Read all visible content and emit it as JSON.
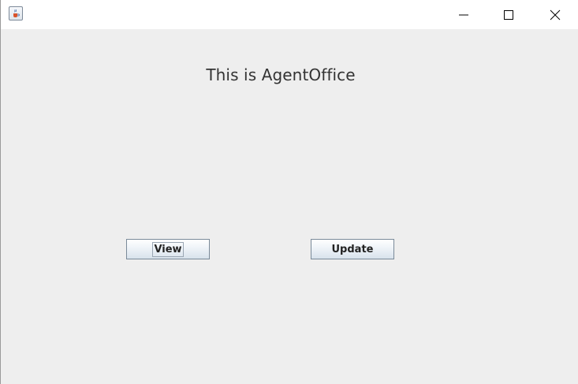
{
  "window": {
    "icon": "java-cup-icon",
    "controls": {
      "minimize_icon": "minimize-icon",
      "maximize_icon": "maximize-icon",
      "close_icon": "close-icon"
    }
  },
  "main": {
    "heading": "This is AgentOffice",
    "buttons": {
      "view_label": "View",
      "update_label": "Update"
    }
  },
  "colors": {
    "content_background": "#eeeeee",
    "titlebar_background": "#ffffff",
    "button_border": "#7a8a99",
    "heading_text": "#333333"
  }
}
